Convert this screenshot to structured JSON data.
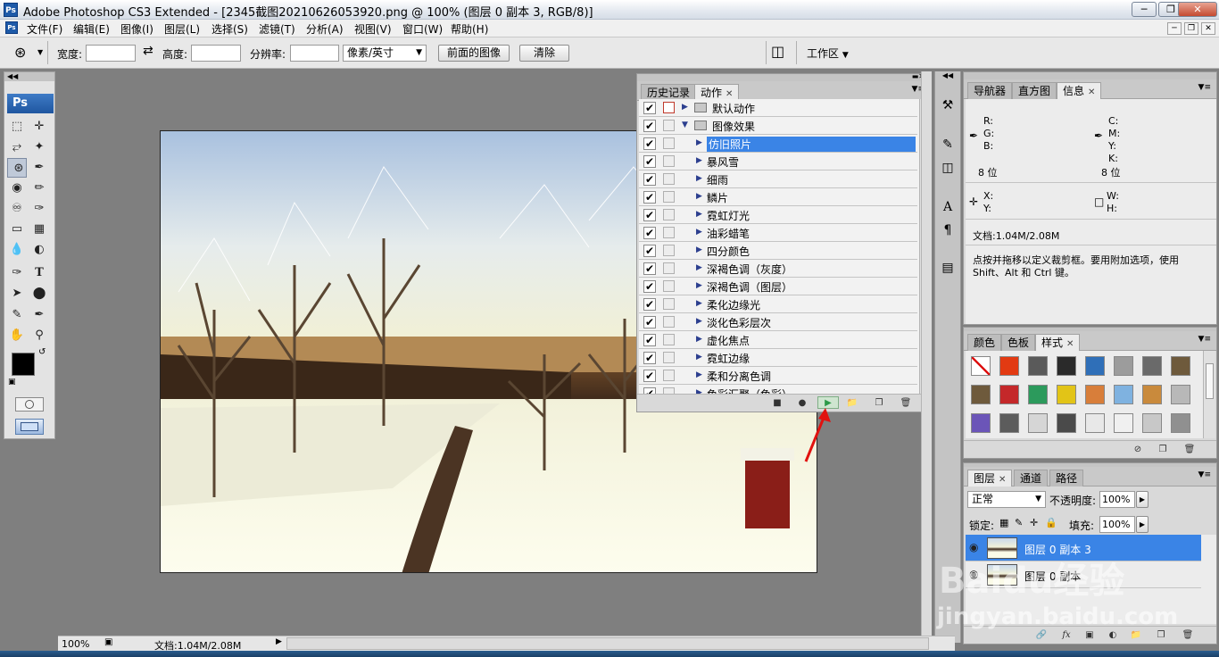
{
  "window": {
    "title": "Adobe Photoshop CS3 Extended - [2345截图20210626053920.png @ 100% (图层 0 副本 3, RGB/8)]",
    "app_icon": "Ps"
  },
  "menubar": {
    "items": [
      "文件(F)",
      "编辑(E)",
      "图像(I)",
      "图层(L)",
      "选择(S)",
      "滤镜(T)",
      "分析(A)",
      "视图(V)",
      "窗口(W)",
      "帮助(H)"
    ]
  },
  "options": {
    "width_label": "宽度:",
    "height_label": "高度:",
    "resolution_label": "分辨率:",
    "unit_value": "像素/英寸",
    "front_image_button": "前面的图像",
    "clear_button": "清除",
    "workspace_label": "工作区"
  },
  "toolbox": {
    "logo": "Ps"
  },
  "actions_panel": {
    "tabs": [
      "历史记录",
      "动作"
    ],
    "items": [
      {
        "name": "默认动作",
        "type": "set",
        "expanded": false,
        "dialog": true
      },
      {
        "name": "图像效果",
        "type": "set",
        "expanded": true,
        "dialog": false
      },
      {
        "name": "仿旧照片",
        "type": "action",
        "selected": true
      },
      {
        "name": "暴风雪",
        "type": "action"
      },
      {
        "name": "细雨",
        "type": "action"
      },
      {
        "name": "鳞片",
        "type": "action"
      },
      {
        "name": "霓虹灯光",
        "type": "action"
      },
      {
        "name": "油彩蜡笔",
        "type": "action"
      },
      {
        "name": "四分颜色",
        "type": "action"
      },
      {
        "name": "深褐色调（灰度）",
        "type": "action"
      },
      {
        "name": "深褐色调（图层）",
        "type": "action"
      },
      {
        "name": "柔化边缘光",
        "type": "action"
      },
      {
        "name": "淡化色彩层次",
        "type": "action"
      },
      {
        "name": "虚化焦点",
        "type": "action"
      },
      {
        "name": "霓虹边缘",
        "type": "action"
      },
      {
        "name": "柔和分离色调",
        "type": "action"
      },
      {
        "name": "色彩汇聚（色彩）",
        "type": "action"
      }
    ]
  },
  "info_panel": {
    "tabs": [
      "导航器",
      "直方图",
      "信息"
    ],
    "r_label": "R:",
    "g_label": "G:",
    "b_label": "B:",
    "c_label": "C:",
    "m_label": "M:",
    "y_label": "Y:",
    "k_label": "K:",
    "bits_left": "8 位",
    "bits_right": "8 位",
    "x_label": "X:",
    "y2_label": "Y:",
    "w_label": "W:",
    "h_label": "H:",
    "doc": "文档:1.04M/2.08M",
    "hint": "点按并拖移以定义裁剪框。要用附加选项，使用 Shift、Alt 和 Ctrl 键。"
  },
  "styles_panel": {
    "tabs": [
      "颜色",
      "色板",
      "样式"
    ],
    "swatch_colors": [
      "#ffffff",
      "#e23a12",
      "#5a5a5a",
      "#2a2a2a",
      "#2f6fb8",
      "#9c9c9c",
      "#6a6a6a",
      "#6e5a3c",
      "#6e5a3c",
      "#c4282a",
      "#2c9a5c",
      "#e2c417",
      "#d87e3a",
      "#7fb2e0",
      "#c98a3c",
      "#b8b8b8",
      "#6b55b8",
      "#5c5c5c",
      "#d6d6d6",
      "#4a4a4a",
      "#e8e8e8",
      "#f0f0f0",
      "#c8c8c8",
      "#909090"
    ]
  },
  "layers_panel": {
    "tabs": [
      "图层",
      "通道",
      "路径"
    ],
    "blend_mode": "正常",
    "opacity_label": "不透明度:",
    "opacity_value": "100%",
    "lock_label": "锁定:",
    "fill_label": "填充:",
    "fill_value": "100%",
    "layers": [
      {
        "name": "图层 0 副本 3",
        "selected": true
      },
      {
        "name": "图层 0 副本",
        "selected": false
      }
    ]
  },
  "statusbar": {
    "zoom": "100%",
    "doc": "文档:1.04M/2.08M"
  },
  "watermark": {
    "text": "Baidu经验",
    "url": "jingyan.baidu.com"
  }
}
